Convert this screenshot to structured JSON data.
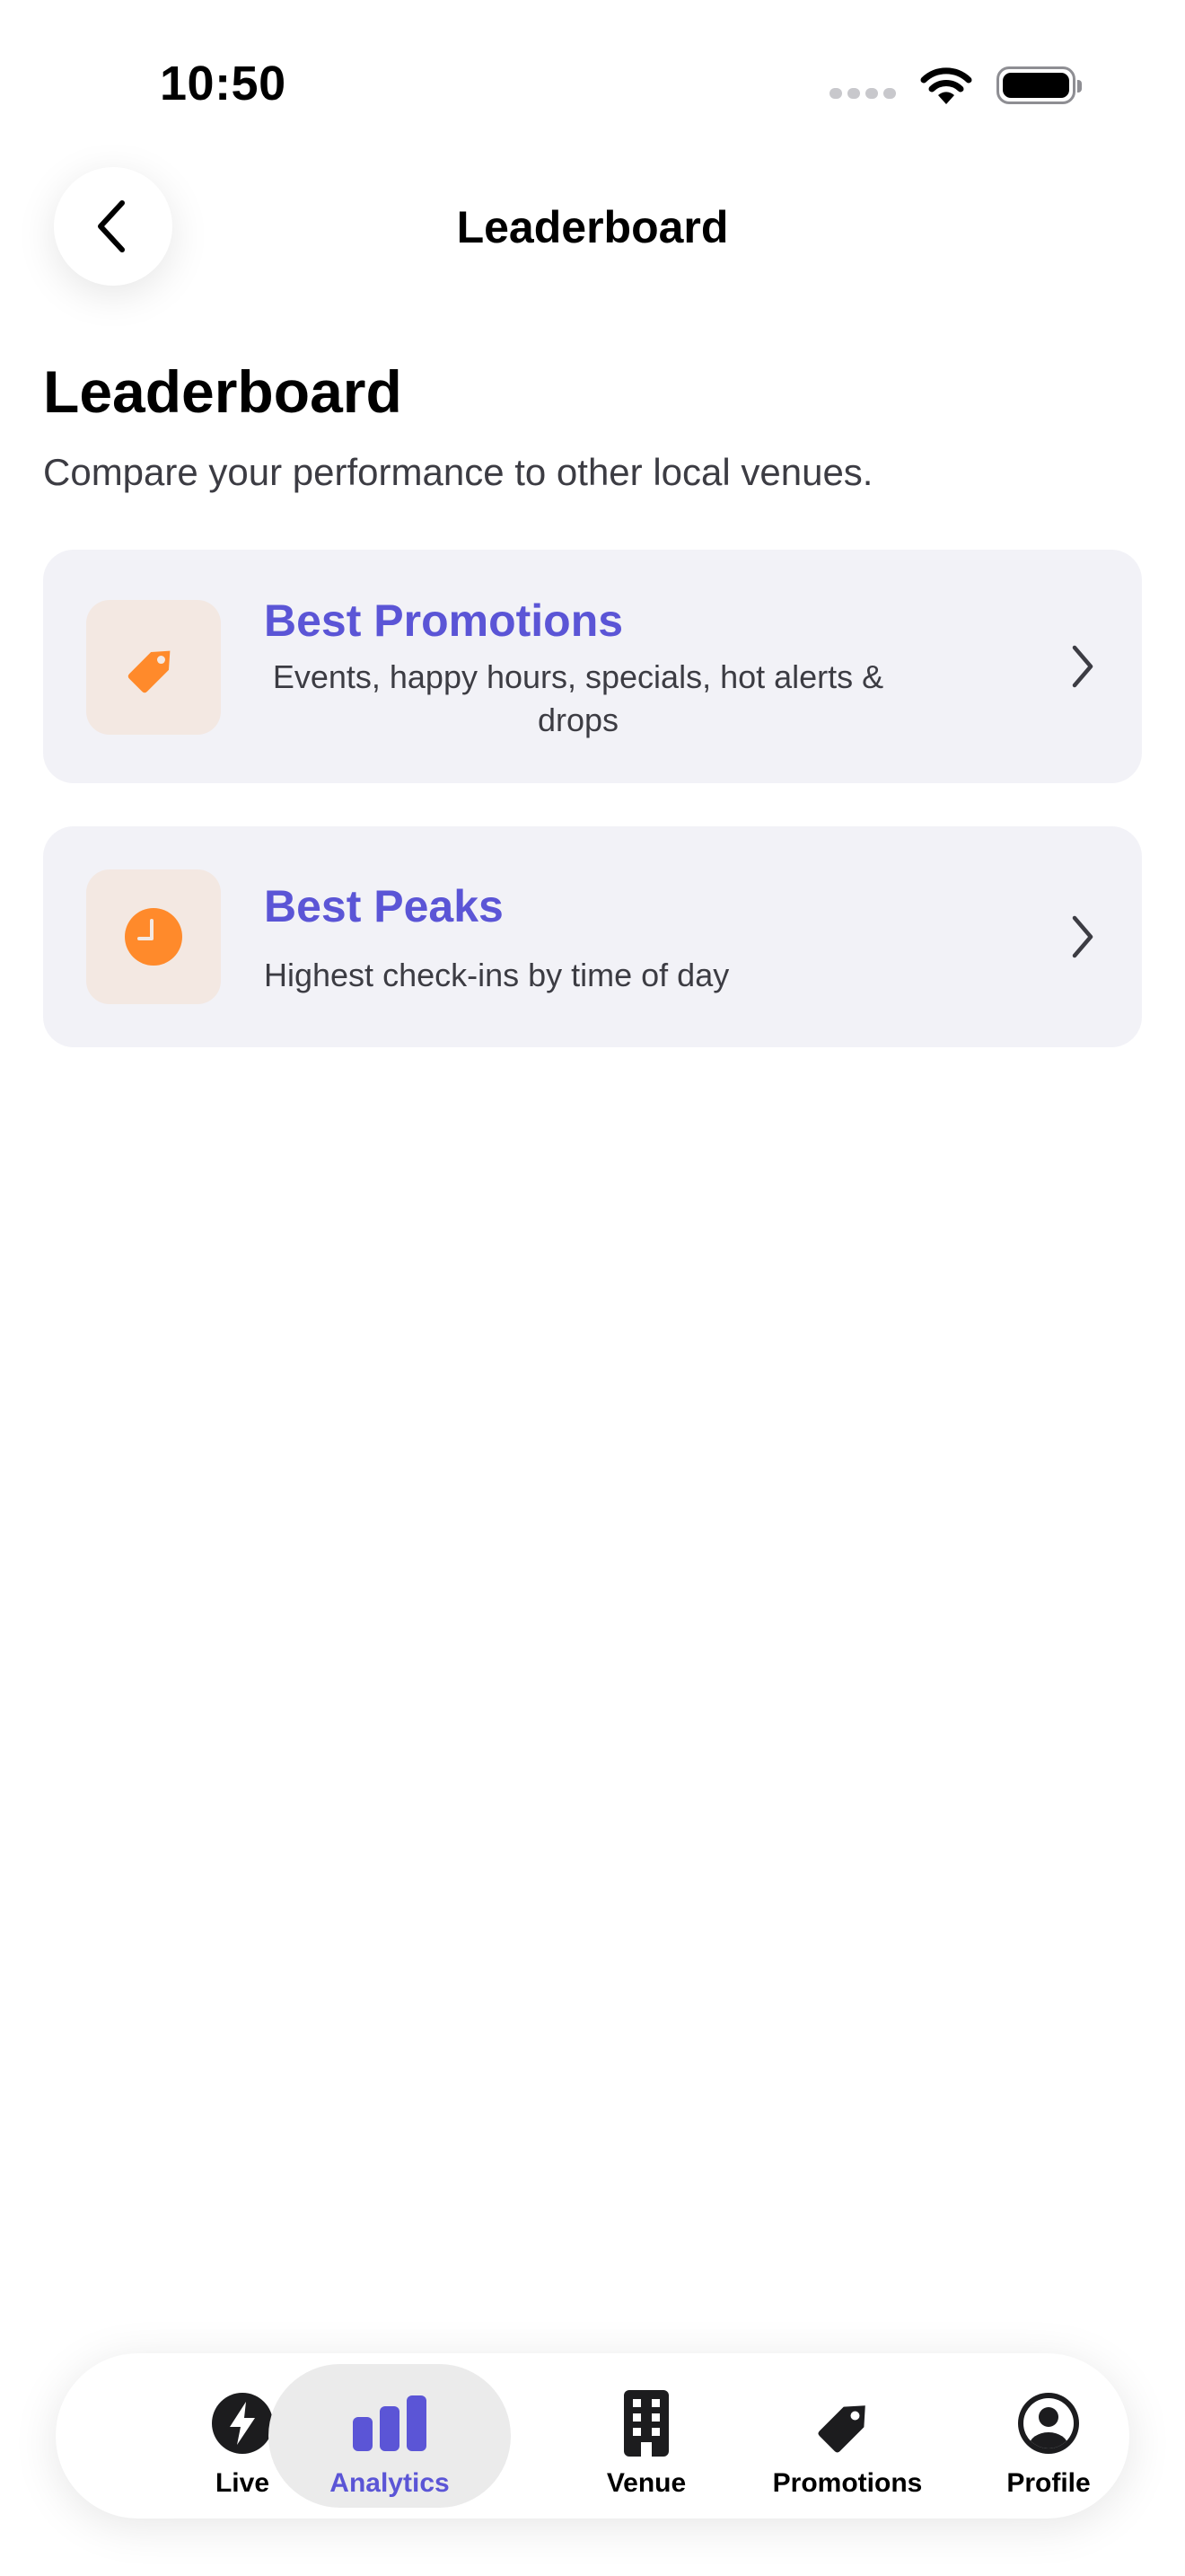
{
  "status_bar": {
    "time": "10:50"
  },
  "header": {
    "title": "Leaderboard"
  },
  "main": {
    "heading": "Leaderboard",
    "subtitle": "Compare your performance to other local venues.",
    "cards": [
      {
        "title": "Best Promotions",
        "description": "Events, happy hours, specials, hot alerts & drops",
        "icon": "tag-icon"
      },
      {
        "title": "Best Peaks",
        "description": "Highest check-ins by time of day",
        "icon": "clock-icon"
      }
    ]
  },
  "tab_bar": {
    "active": "Analytics",
    "items": [
      {
        "label": "Live",
        "icon": "bolt-icon"
      },
      {
        "label": "Analytics",
        "icon": "bar-chart-icon"
      },
      {
        "label": "Venue",
        "icon": "building-icon"
      },
      {
        "label": "Promotions",
        "icon": "tag-icon"
      },
      {
        "label": "Profile",
        "icon": "person-icon"
      }
    ]
  },
  "colors": {
    "accent": "#5B55D6",
    "icon_orange": "#FF8A2B",
    "card_bg": "#F2F2F7",
    "icon_box_bg": "#F3E8E2"
  }
}
